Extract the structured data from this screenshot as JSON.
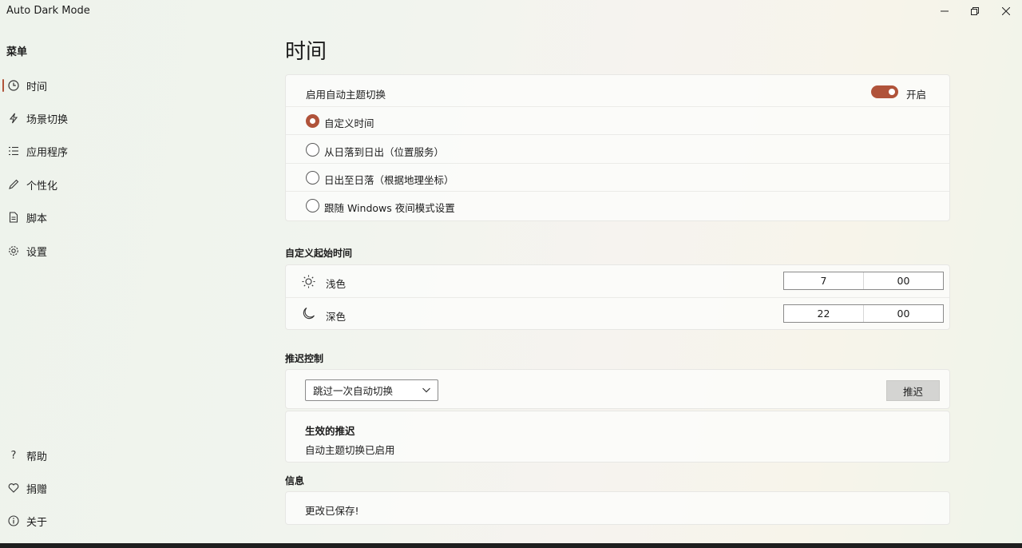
{
  "window": {
    "title": "Auto Dark Mode",
    "controls": {
      "minimize": "—",
      "restore": "⧉",
      "close": "✕"
    }
  },
  "sidebar": {
    "menu_title": "菜单",
    "items": [
      {
        "label": "时间",
        "icon": "clock-icon",
        "active": true
      },
      {
        "label": "场景切换",
        "icon": "bolt-icon",
        "active": false
      },
      {
        "label": "应用程序",
        "icon": "list-icon",
        "active": false
      },
      {
        "label": "个性化",
        "icon": "pen-icon",
        "active": false
      },
      {
        "label": "脚本",
        "icon": "document-icon",
        "active": false
      },
      {
        "label": "设置",
        "icon": "gear-icon",
        "active": false
      }
    ],
    "footer_items": [
      {
        "label": "帮助",
        "icon": "question-icon"
      },
      {
        "label": "捐赠",
        "icon": "heart-icon"
      },
      {
        "label": "关于",
        "icon": "info-icon"
      }
    ]
  },
  "page": {
    "title": "时间"
  },
  "theme_switch": {
    "label": "启用自动主题切换",
    "toggle_state": "开启",
    "options": [
      {
        "label": "自定义时间",
        "checked": true
      },
      {
        "label": "从日落到日出（位置服务）",
        "checked": false
      },
      {
        "label": "日出至日落（根据地理坐标）",
        "checked": false
      },
      {
        "label": "跟随 Windows 夜间模式设置",
        "checked": false
      }
    ]
  },
  "custom_times": {
    "section_label": "自定义起始时间",
    "light": {
      "label": "浅色",
      "icon": "sun-icon",
      "hour": "7",
      "minute": "00"
    },
    "dark": {
      "label": "深色",
      "icon": "moon-icon",
      "hour": "22",
      "minute": "00"
    }
  },
  "postpone": {
    "section_label": "推迟控制",
    "dropdown_value": "跳过一次自动切换",
    "button_label": "推迟",
    "active_title": "生效的推迟",
    "active_status": "自动主题切换已启用"
  },
  "info": {
    "section_label": "信息",
    "message": "更改已保存!"
  },
  "colors": {
    "accent": "#b0533a"
  }
}
